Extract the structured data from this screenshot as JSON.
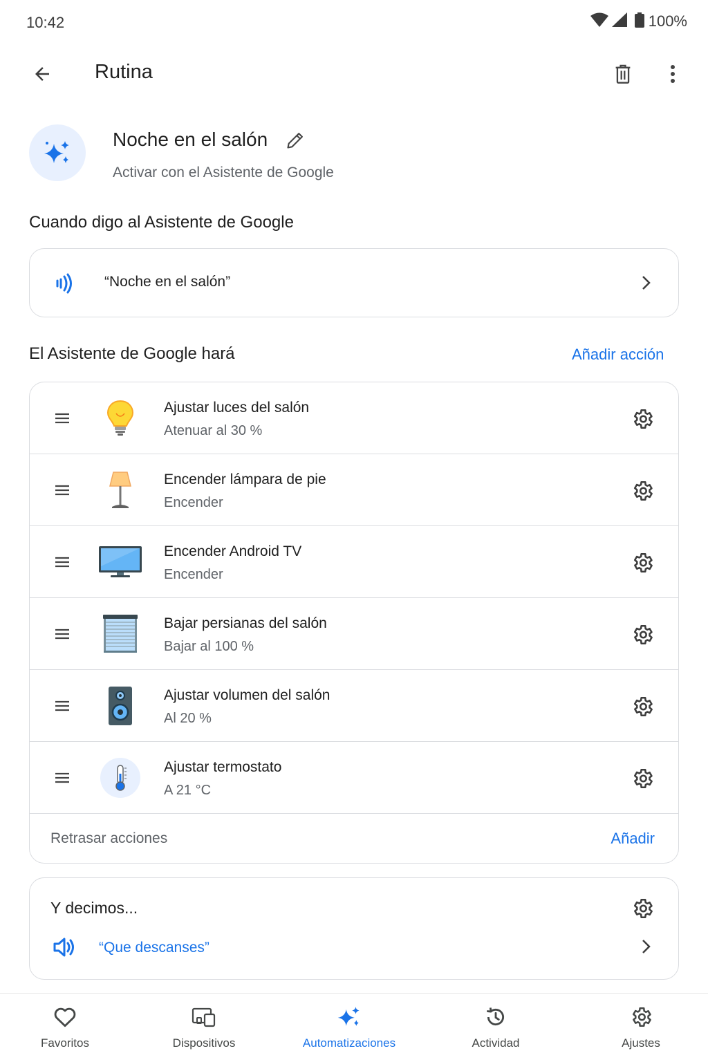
{
  "status_bar": {
    "time": "10:42",
    "battery": "100%"
  },
  "app_bar": {
    "title": "Rutina"
  },
  "routine": {
    "name": "Noche en el salón",
    "subtitle": "Activar con el Asistente de Google"
  },
  "starter": {
    "section_title": "Cuando digo al Asistente de Google",
    "phrase": "“Noche en el salón”"
  },
  "actions": {
    "section_title": "El Asistente de Google hará",
    "add_action_label": "Añadir acción",
    "items": [
      {
        "title": "Ajustar luces del salón",
        "subtitle": "Atenuar al 30 %",
        "icon": "lightbulb-icon"
      },
      {
        "title": "Encender lámpara de pie",
        "subtitle": "Encender",
        "icon": "floor-lamp-icon"
      },
      {
        "title": "Encender Android TV",
        "subtitle": "Encender",
        "icon": "tv-icon"
      },
      {
        "title": "Bajar persianas del salón",
        "subtitle": "Bajar al 100 %",
        "icon": "blinds-icon"
      },
      {
        "title": "Ajustar volumen del salón",
        "subtitle": "Al 20 %",
        "icon": "speaker-icon"
      },
      {
        "title": "Ajustar termostato",
        "subtitle": "A 21 °C",
        "icon": "thermometer-icon"
      }
    ],
    "delay_label": "Retrasar acciones",
    "delay_add_label": "Añadir"
  },
  "reply": {
    "title": "Y decimos...",
    "text": "“Que descanses”"
  },
  "bottom_nav": {
    "items": [
      {
        "label": "Favoritos",
        "icon": "heart-icon",
        "active": false
      },
      {
        "label": "Dispositivos",
        "icon": "devices-icon",
        "active": false
      },
      {
        "label": "Automatizaciones",
        "icon": "sparkle-icon",
        "active": true
      },
      {
        "label": "Actividad",
        "icon": "history-icon",
        "active": false
      },
      {
        "label": "Ajustes",
        "icon": "gear-icon",
        "active": false
      }
    ]
  },
  "colors": {
    "accent": "#1a73e8",
    "divider": "#dadce0",
    "secondary_text": "#5f6368"
  }
}
